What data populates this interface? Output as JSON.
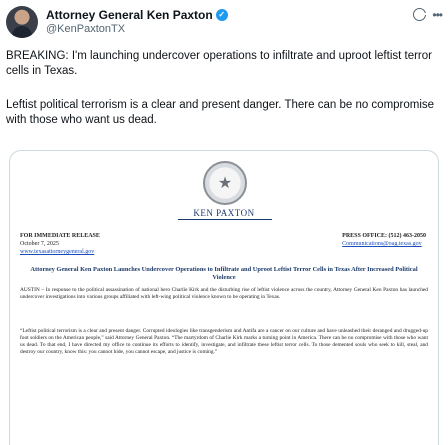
{
  "author": {
    "name": "Attorney General Ken Paxton",
    "handle": "@KenPaxtonTX"
  },
  "icons": {
    "verified": "verified-badge-icon",
    "grok": "grok-icon",
    "more": "more-icon"
  },
  "tweet": {
    "paragraph1": "BREAKING: I'm launching undercover operations to infiltrate and uproot leftist terror cells in Texas.",
    "paragraph2": "Leftist political terrorism is a clear and present danger. There can be no compromise with those who want us dead."
  },
  "document": {
    "seal_name": "KEN PAXTON",
    "release_label": "FOR IMMEDIATE RELEASE",
    "date": "October 7, 2025",
    "site": "www.texasattorneygeneral.gov",
    "press_office": "PRESS OFFICE: (512) 463-2050",
    "press_email": "Communications@oag.texas.gov",
    "headline": "Attorney General Ken Paxton Launches Undercover Operations to Infiltrate and Uproot Leftist Terror Cells in Texas After Increased Political Violence",
    "paragraph1": "AUSTIN – In response to the political assassination of national hero Charlie Kirk and the disturbing rise of leftist violence across the country, Attorney General Ken Paxton has launched undercover investigations into various groups affiliated with left-wing political violence known to be operating in Texas.",
    "paragraph2": "“Leftist political terrorism is a clear and present danger. Corrupted ideologies like transgenderism and Antifa are a cancer on our culture and have unleashed their deranged and drugged-up foot soldiers on the American people,” said Attorney General Paxton. “The martyrdom of Charlie Kirk marks a turning point in America. There can be no compromise with those who want us dead. To that end, I have directed my office to continue its efforts to identify, investigate, and infiltrate these leftist terror cells. To those demented souls who seek to kill, steal, and destroy our country, know this: you cannot hide, you cannot escape, and justice is coming.”"
  },
  "colors": {
    "verified": "#1d9bf0",
    "doc_blue": "#1b3a6b",
    "secondary_text": "#536471"
  }
}
